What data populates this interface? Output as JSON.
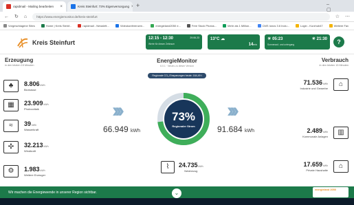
{
  "browser": {
    "tabs": [
      {
        "label": "rapidmail - Mailing bearbeiten",
        "color": "#d93025"
      },
      {
        "label": "Kreis Steinfurt: 73% Eigenversorgung",
        "color": "#1a73e8"
      }
    ],
    "new_tab": "+",
    "url": "https://www.energiemonitor.de/kreis-steinfurt",
    "bookmarks": [
      {
        "label": "Vorgeschlagene Sites",
        "color": "#888888"
      },
      {
        "label": "Home | Kreis Steinf...",
        "color": "#1c7a4a"
      },
      {
        "label": "rapidmail - Newslett...",
        "color": "#d93025"
      },
      {
        "label": "Videokonferenzen...",
        "color": "#1a73e8"
      },
      {
        "label": "energieland2050 e...",
        "color": "#34a853"
      },
      {
        "label": "Free Stock Photos...",
        "color": "#555555"
      },
      {
        "label": "Mehr als 1 Million...",
        "color": "#0f9d58"
      },
      {
        "label": "CMS Ionos 3.6 Inclu...",
        "color": "#4285f4"
      },
      {
        "label": "Login - Kurzhub47",
        "color": "#f4b400"
      },
      {
        "label": "Weitere Fav",
        "color": "#f4b400"
      }
    ]
  },
  "header": {
    "brand": "Kreis Steinfurt",
    "time_range": "12:15 - 12:30",
    "time_date": "29.06.23",
    "time_sub": "Werte für diesen Zeitraum",
    "temp": "13°C",
    "temp_sub": "99% Bewölkung",
    "wind": "14",
    "wind_unit": "m/s",
    "wind_sub": "Wind",
    "sunrise": "05:23",
    "sunset": "21:30",
    "sun_sub": "Sonnenauf- und untergang",
    "help": "?"
  },
  "monitor": {
    "title": "EnergieMonitor",
    "subtitle": "6.0.1 · Neues zu dieser Version",
    "pill": "Regionale CO₂-Einsparungen heute: 164,49 t"
  },
  "erzeugung": {
    "title": "Erzeugung",
    "sub": "in den letzten 15 Minuten",
    "items": [
      {
        "value": "8.806",
        "unit": "kWh",
        "label": "Biomasse",
        "icon": "biomass-icon"
      },
      {
        "value": "23.909",
        "unit": "kWh",
        "label": "Photovoltaik",
        "icon": "solar-panel-icon"
      },
      {
        "value": "39",
        "unit": "kWh",
        "label": "Wasserkraft",
        "icon": "water-icon"
      },
      {
        "value": "32.213",
        "unit": "kWh",
        "label": "Windkraft",
        "icon": "wind-turbine-icon"
      },
      {
        "value": "1.983",
        "unit": "kWh",
        "label": "Weitere Erzeuger",
        "icon": "other-producers-icon"
      }
    ],
    "total": "66.949",
    "total_unit": "kWh"
  },
  "verbrauch": {
    "title": "Verbrauch",
    "sub": "in den letzten 15 Minuten",
    "items": [
      {
        "value": "71.536",
        "unit": "kWh",
        "label": "Industrie und Gewerbe",
        "icon": "factory-icon"
      },
      {
        "value": "2.489",
        "unit": "kWh",
        "label": "Kommunale Anlagen",
        "icon": "municipal-building-icon"
      },
      {
        "value": "17.659",
        "unit": "kWh",
        "label": "Private Haushalte",
        "icon": "household-icon"
      }
    ],
    "total": "91.684",
    "total_unit": "kWh"
  },
  "center": {
    "percent": "73%",
    "percent_value": 73,
    "label": "Regionaler Strom",
    "arrows": "›››"
  },
  "netz": {
    "value": "24.735",
    "unit": "kWh",
    "label": "Netzbezug"
  },
  "footer": {
    "text": "Wir machen die Energiewende in unserer Region sichtbar.",
    "logo": "energieland 2050"
  },
  "colors": {
    "brand_green": "#1c7a4a",
    "ring_green": "#3fae5a",
    "ring_track": "#d5dde5",
    "arrow_blue": "#8ab0cc"
  }
}
